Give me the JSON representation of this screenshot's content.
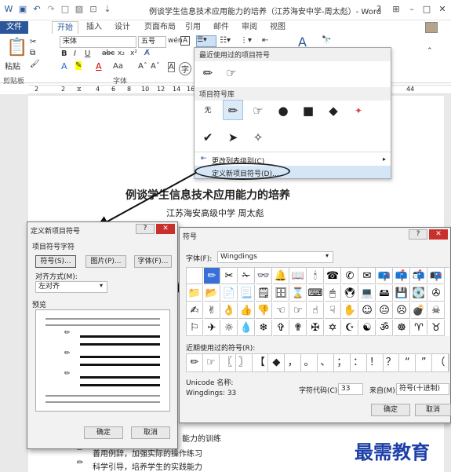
{
  "window": {
    "title": "例谈学生信息技术应用能力的培养（江苏海安中学-周太彪）- Word",
    "help": "?",
    "min": "–",
    "max": "□",
    "close": "✕"
  },
  "tabs": {
    "file": "文件",
    "home": "开始",
    "insert": "插入",
    "design": "设计",
    "layout": "页面布局",
    "references": "引用",
    "mailings": "邮件",
    "review": "审阅",
    "view": "视图"
  },
  "ribbon": {
    "paste": "粘贴",
    "font_name": "宋体",
    "font_size": "五号",
    "clipboard_group": "剪贴板",
    "font_group": "字体",
    "bold": "B",
    "italic": "I",
    "underline": "U",
    "strike": "abc",
    "sub": "x₂",
    "sup": "x²"
  },
  "ruler": {
    "ticks": [
      "2",
      "2",
      "4",
      "6",
      "8",
      "10",
      "12",
      "14",
      "16"
    ],
    "right_tick": "44"
  },
  "bullet_dropdown": {
    "recent_header": "最近使用过的项目符号",
    "library_header": "项目符号库",
    "none_label": "无",
    "change_level": "更改列表级别(C)",
    "define_new": "定义新项目符号(D)..."
  },
  "document": {
    "heading": "例谈学生信息技术应用能力的培养",
    "author": "江苏海安高级中学  周太彪",
    "line1": "能力的训练",
    "line2": "善用例辞，加强实际的操作练习",
    "line3": "科学引导，培养学生的实践能力"
  },
  "define_dialog": {
    "title": "定义新项目符号",
    "section": "项目符号字符",
    "symbol_btn": "符号(S)...",
    "picture_btn": "图片(P)...",
    "font_btn": "字体(F)...",
    "align_label": "对齐方式(M):",
    "align_value": "左对齐",
    "preview_label": "预览",
    "ok": "确定",
    "cancel": "取消",
    "help": "?",
    "close": "✕"
  },
  "symbol_dialog": {
    "title": "符号",
    "font_label": "字体(F):",
    "font_value": "Wingdings",
    "recent_label": "近期使用过的符号(R):",
    "unicode_label": "Unicode 名称:",
    "unicode_value": "Wingdings: 33",
    "charcode_label": "字符代码(C):",
    "charcode_value": "33",
    "from_label": "来自(M):",
    "from_value": "符号(十进制)",
    "ok": "确定",
    "cancel": "取消",
    "help": "?",
    "close": "✕",
    "grid": [
      [
        "",
        "✏",
        "✂",
        "✁",
        "👓",
        "🔔",
        "📖",
        "🕯",
        "☎",
        "✆",
        "✉",
        "📪",
        "📫",
        "📬",
        "📭"
      ],
      [
        "📁",
        "📂",
        "📄",
        "📃",
        "🗒",
        "🗄",
        "⌛",
        "⌨",
        "🖱",
        "🖲",
        "💻",
        "🖴",
        "💾",
        "💽",
        "✇"
      ],
      [
        "✍",
        "✌",
        "👌",
        "👍",
        "👎",
        "☜",
        "☞",
        "☝",
        "☟",
        "✋",
        "☺",
        "😐",
        "☹",
        "💣",
        "☠"
      ],
      [
        "⚐",
        "✈",
        "☼",
        "💧",
        "❄",
        "✞",
        "✟",
        "✠",
        "✡",
        "☪",
        "☯",
        "ॐ",
        "☸",
        "♈",
        "♉"
      ]
    ],
    "recent": [
      "✏",
      "☞",
      "〖",
      "〗",
      "【",
      "◆",
      "，",
      "。",
      "、",
      "；",
      "：",
      "！",
      "？",
      "“",
      "”",
      "（"
    ]
  },
  "watermark": "最需教育"
}
